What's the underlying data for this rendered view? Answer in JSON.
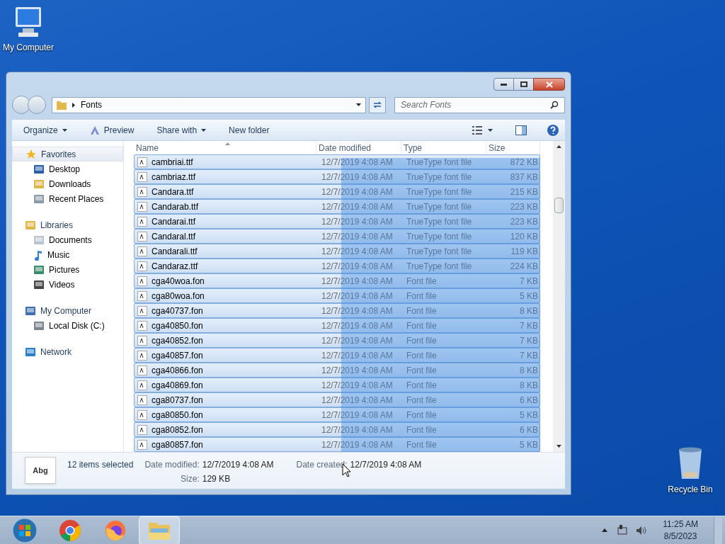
{
  "desktop_icons": [
    {
      "label": "My Computer",
      "kind": "computer"
    },
    {
      "label": "Recycle Bin",
      "kind": "recycle"
    }
  ],
  "window": {
    "address": "Fonts",
    "search": {
      "placeholder": "Search Fonts"
    },
    "toolbar": [
      {
        "label": "Organize",
        "kind": "menu"
      },
      {
        "label": "Preview",
        "kind": "icon"
      },
      {
        "label": "Share with",
        "kind": "menu"
      },
      {
        "label": "New folder",
        "kind": "plain"
      }
    ],
    "sidebar": [
      {
        "label": "Favorites",
        "kind": "star",
        "selected": true,
        "children": [
          {
            "label": "Desktop",
            "kind": "desktop",
            "selected": false
          },
          {
            "label": "Downloads",
            "kind": "downloads",
            "selected": false
          },
          {
            "label": "Recent Places",
            "kind": "recent",
            "selected": false
          }
        ]
      },
      {
        "label": "Libraries",
        "kind": "libraries",
        "selected": false,
        "children": [
          {
            "label": "Documents",
            "kind": "documents",
            "selected": false
          },
          {
            "label": "Music",
            "kind": "music",
            "selected": false
          },
          {
            "label": "Pictures",
            "kind": "pictures",
            "selected": false
          },
          {
            "label": "Videos",
            "kind": "videos",
            "selected": false
          }
        ]
      },
      {
        "label": "My Computer",
        "kind": "computer",
        "selected": false,
        "children": [
          {
            "label": "Local Disk (C:)",
            "kind": "disk",
            "selected": false
          }
        ]
      },
      {
        "label": "Network",
        "kind": "network",
        "selected": false
      }
    ],
    "columns": [
      {
        "label": "Name",
        "sorted": true
      },
      {
        "label": "Date modified",
        "sorted": false
      },
      {
        "label": "Type",
        "sorted": false
      },
      {
        "label": "Size",
        "sorted": false
      }
    ],
    "rows": [
      {
        "name": "cambriai.ttf",
        "date": "12/7/2019 4:08 AM",
        "type": "TrueType font file",
        "size": "872 KB",
        "selected": true
      },
      {
        "name": "cambriaz.ttf",
        "date": "12/7/2019 4:08 AM",
        "type": "TrueType font file",
        "size": "837 KB",
        "selected": true
      },
      {
        "name": "Candara.ttf",
        "date": "12/7/2019 4:08 AM",
        "type": "TrueType font file",
        "size": "215 KB",
        "selected": true
      },
      {
        "name": "Candarab.ttf",
        "date": "12/7/2019 4:08 AM",
        "type": "TrueType font file",
        "size": "223 KB",
        "selected": true
      },
      {
        "name": "Candarai.ttf",
        "date": "12/7/2019 4:08 AM",
        "type": "TrueType font file",
        "size": "223 KB",
        "selected": true
      },
      {
        "name": "Candaral.ttf",
        "date": "12/7/2019 4:08 AM",
        "type": "TrueType font file",
        "size": "120 KB",
        "selected": true
      },
      {
        "name": "Candarali.ttf",
        "date": "12/7/2019 4:08 AM",
        "type": "TrueType font file",
        "size": "119 KB",
        "selected": true
      },
      {
        "name": "Candaraz.ttf",
        "date": "12/7/2019 4:08 AM",
        "type": "TrueType font file",
        "size": "224 KB",
        "selected": true
      },
      {
        "name": "cga40woa.fon",
        "date": "12/7/2019 4:08 AM",
        "type": "Font file",
        "size": "7 KB",
        "selected": true
      },
      {
        "name": "cga80woa.fon",
        "date": "12/7/2019 4:08 AM",
        "type": "Font file",
        "size": "5 KB",
        "selected": true
      },
      {
        "name": "cga40737.fon",
        "date": "12/7/2019 4:08 AM",
        "type": "Font file",
        "size": "8 KB",
        "selected": true
      },
      {
        "name": "cga40850.fon",
        "date": "12/7/2019 4:08 AM",
        "type": "Font file",
        "size": "7 KB",
        "selected": true
      },
      {
        "name": "cga40852.fon",
        "date": "12/7/2019 4:08 AM",
        "type": "Font file",
        "size": "7 KB",
        "selected": true
      },
      {
        "name": "cga40857.fon",
        "date": "12/7/2019 4:08 AM",
        "type": "Font file",
        "size": "7 KB",
        "selected": true
      },
      {
        "name": "cga40866.fon",
        "date": "12/7/2019 4:08 AM",
        "type": "Font file",
        "size": "8 KB",
        "selected": true
      },
      {
        "name": "cga40869.fon",
        "date": "12/7/2019 4:08 AM",
        "type": "Font file",
        "size": "8 KB",
        "selected": true
      },
      {
        "name": "cga80737.fon",
        "date": "12/7/2019 4:08 AM",
        "type": "Font file",
        "size": "6 KB",
        "selected": true
      },
      {
        "name": "cga80850.fon",
        "date": "12/7/2019 4:08 AM",
        "type": "Font file",
        "size": "5 KB",
        "selected": true
      },
      {
        "name": "cga80852.fon",
        "date": "12/7/2019 4:08 AM",
        "type": "Font file",
        "size": "6 KB",
        "selected": true
      },
      {
        "name": "cga80857.fon",
        "date": "12/7/2019 4:08 AM",
        "type": "Font file",
        "size": "5 KB",
        "selected": true
      }
    ],
    "details": {
      "thumbnail": "Abg",
      "summary": "12 items selected",
      "fields": [
        {
          "label": "Date modified:",
          "value": "12/7/2019 4:08 AM"
        },
        {
          "label": "Size:",
          "value": "129 KB"
        },
        {
          "label": "Date created:",
          "value": "12/7/2019 4:08 AM"
        }
      ]
    }
  },
  "taskbar": {
    "apps": [
      {
        "kind": "start",
        "selected": false
      },
      {
        "kind": "chrome",
        "selected": false
      },
      {
        "kind": "firefox",
        "selected": false
      },
      {
        "kind": "explorer",
        "selected": true
      }
    ],
    "time": "11:25 AM",
    "date": "8/5/2023"
  }
}
